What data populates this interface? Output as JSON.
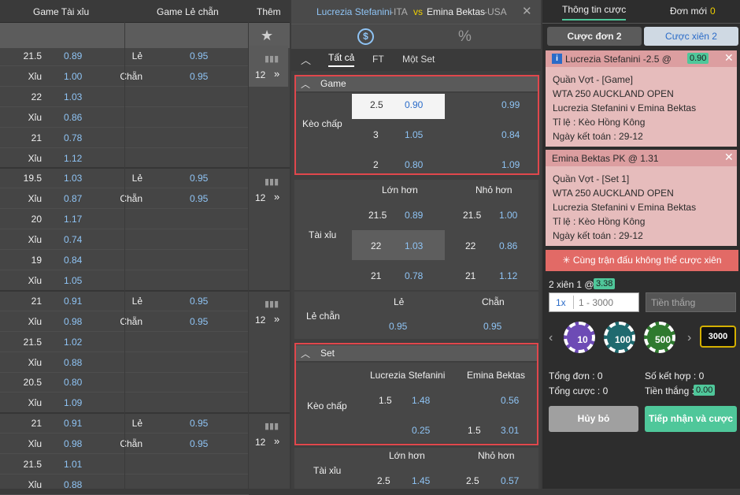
{
  "left": {
    "headers": [
      "Game Tài xỉu",
      "Game Lẻ chẵn",
      "Thêm"
    ],
    "more_icon": "star-icon",
    "rows": [
      {
        "k": "21.5",
        "o": "0.89",
        "lk": "Lẻ",
        "lo": "0.95"
      },
      {
        "k": "Xỉu",
        "o": "1.00",
        "lk": "Chẵn",
        "lo": "0.95"
      },
      {
        "k": "22",
        "o": "1.03",
        "lk": "",
        "lo": ""
      },
      {
        "k": "Xỉu",
        "o": "0.86",
        "lk": "",
        "lo": ""
      },
      {
        "k": "21",
        "o": "0.78",
        "lk": "",
        "lo": ""
      },
      {
        "k": "Xỉu",
        "o": "1.12",
        "lk": "",
        "lo": ""
      },
      {
        "k": "19.5",
        "o": "1.03",
        "lk": "Lẻ",
        "lo": "0.95"
      },
      {
        "k": "Xỉu",
        "o": "0.87",
        "lk": "Chẵn",
        "lo": "0.95"
      },
      {
        "k": "20",
        "o": "1.17",
        "lk": "",
        "lo": ""
      },
      {
        "k": "Xỉu",
        "o": "0.74",
        "lk": "",
        "lo": ""
      },
      {
        "k": "19",
        "o": "0.84",
        "lk": "",
        "lo": ""
      },
      {
        "k": "Xỉu",
        "o": "1.05",
        "lk": "",
        "lo": ""
      },
      {
        "k": "21",
        "o": "0.91",
        "lk": "Lẻ",
        "lo": "0.95"
      },
      {
        "k": "Xỉu",
        "o": "0.98",
        "lk": "Chẵn",
        "lo": "0.95"
      },
      {
        "k": "21.5",
        "o": "1.02",
        "lk": "",
        "lo": ""
      },
      {
        "k": "Xỉu",
        "o": "0.88",
        "lk": "",
        "lo": ""
      },
      {
        "k": "20.5",
        "o": "0.80",
        "lk": "",
        "lo": ""
      },
      {
        "k": "Xỉu",
        "o": "1.09",
        "lk": "",
        "lo": ""
      },
      {
        "k": "21",
        "o": "0.91",
        "lk": "Lẻ",
        "lo": "0.95"
      },
      {
        "k": "Xỉu",
        "o": "0.98",
        "lk": "Chẵn",
        "lo": "0.95"
      },
      {
        "k": "21.5",
        "o": "1.01",
        "lk": "",
        "lo": ""
      },
      {
        "k": "Xỉu",
        "o": "0.88",
        "lk": "",
        "lo": ""
      }
    ],
    "more_count": "12",
    "more_arrow": "»"
  },
  "match": {
    "home": "Lucrezia Stefanini",
    "home_cc": "-ITA",
    "vs": "vs",
    "away": "Emina Bektas",
    "away_cc": "-USA",
    "close": "✕",
    "money_icon": "$",
    "percent_icon": "%",
    "tabs": [
      "Tất cả",
      "FT",
      "Một Set"
    ],
    "game_label": "Game",
    "keo_chap": "Kèo chấp",
    "game_rows": [
      {
        "h": "2.5",
        "ho": "0.90",
        "ao": "0.99"
      },
      {
        "h": "3",
        "ho": "1.05",
        "ao": "0.84"
      },
      {
        "h": "2",
        "ho": "0.80",
        "ao": "1.09"
      }
    ],
    "tai_xiu": "Tài xỉu",
    "lon_hon": "Lớn hơn",
    "nho_hon": "Nhỏ hơn",
    "tx_rows": [
      {
        "a": "21.5",
        "ao": "0.89",
        "b": "21.5",
        "bo": "1.00"
      },
      {
        "a": "22",
        "ao": "1.03",
        "b": "22",
        "bo": "0.86"
      },
      {
        "a": "21",
        "ao": "0.78",
        "b": "21",
        "bo": "1.12"
      }
    ],
    "le_chan": "Lẻ chẵn",
    "le": "Lẻ",
    "chan": "Chẵn",
    "le_o": "0.95",
    "chan_o": "0.95",
    "set_label": "Set",
    "set_home": "Lucrezia Stefanini",
    "set_away": "Emina Bektas",
    "set_rows": [
      {
        "h": "1.5",
        "ho": "1.48",
        "a": "",
        "ao": "0.56"
      },
      {
        "h": "",
        "ho": "0.25",
        "a": "1.5",
        "ao": "3.01"
      }
    ],
    "set_tx": {
      "a": "2.5",
      "ao": "1.45",
      "b": "2.5",
      "bo": "0.57"
    }
  },
  "slip": {
    "tab_info": "Thông tin cược",
    "tab_new": "Đơn mới",
    "new_count": "0",
    "single": "Cược đơn 2",
    "parlay": "Cược xiên 2",
    "bet1": {
      "title": "Lucrezia Stefanini -2.5 @",
      "odds": "0.90",
      "l1": "Quần Vợt - [Game]",
      "l2": "WTA 250 AUCKLAND OPEN",
      "l3": "Lucrezia Stefanini v Emina Bektas",
      "l4": "Tỉ lệ : Kèo Hồng Kông",
      "l5": "Ngày kết toán : 29-12"
    },
    "bet2": {
      "title": "Emina Bektas PK @ 1.31",
      "l1": "Quần Vợt - [Set 1]",
      "l2": "WTA 250 AUCKLAND OPEN",
      "l3": "Lucrezia Stefanini v Emina Bektas",
      "l4": "Tỉ lệ : Kèo Hồng Kông",
      "l5": "Ngày kết toán : 29-12"
    },
    "warning": "✳ Cùng trận đấu không thể cược xiên",
    "combo": "2 xiên 1 @",
    "combo_odds": "3.38",
    "mult": "1x",
    "range_ph": "1 - 3000",
    "win_ph": "Tiền thắng",
    "chips": [
      "10",
      "100",
      "500",
      "3000"
    ],
    "tong_don": "Tổng đơn : 0",
    "so_ket_hop": "Số kết hợp : 0",
    "tong_cuoc": "Tổng cược : 0",
    "tien_thang": "Tiền thắng :",
    "tien_thang_val": "0.00",
    "cancel": "Hủy bỏ",
    "accept": "Tiếp nhận và cược",
    "colors": {
      "accent_green": "#4fc79a",
      "bet_bg": "#e6bcbc",
      "bet_head": "#dc9ea0",
      "warn": "#e26a66",
      "yellow": "#f0d000"
    }
  }
}
